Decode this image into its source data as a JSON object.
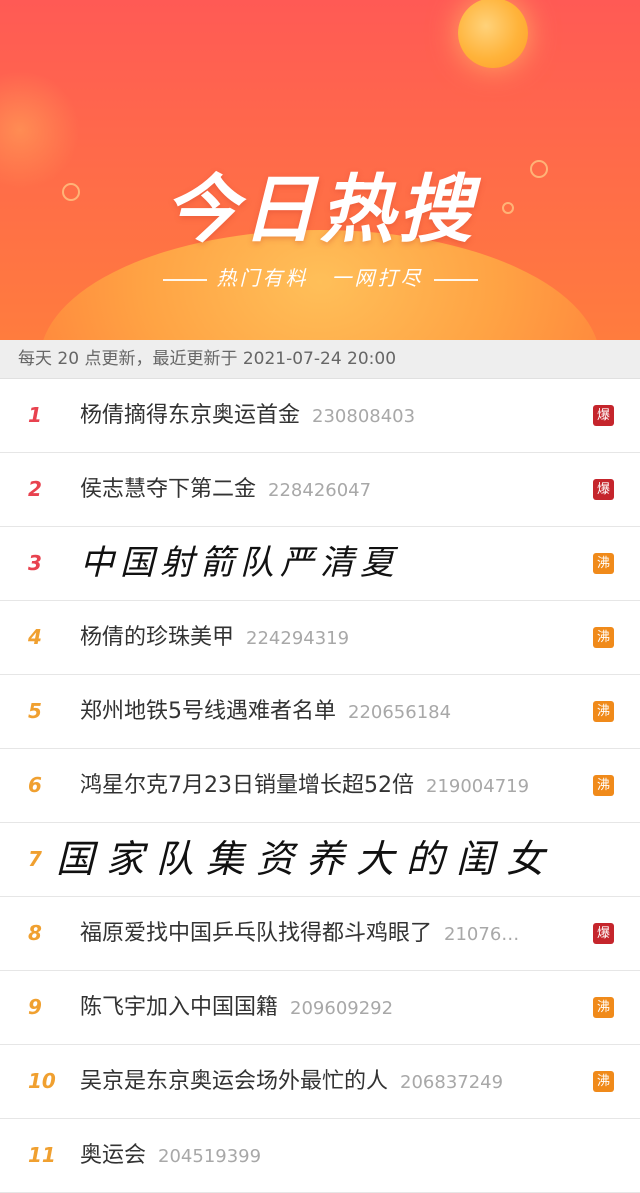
{
  "banner": {
    "title": "今日热搜",
    "subtitle": "热门有料　一网打尽"
  },
  "update_text": "每天 20 点更新，最近更新于 2021-07-24 20:00",
  "badge_colors": {
    "爆": "#c5252c",
    "沸": "#f08a1a"
  },
  "items": [
    {
      "rank": "1",
      "title": "杨倩摘得东京奥运首金",
      "count": "230808403",
      "badge": "爆"
    },
    {
      "rank": "2",
      "title": "侯志慧夺下第二金",
      "count": "228426047",
      "badge": "爆"
    },
    {
      "rank": "3",
      "title": "中国射箭队严清夏",
      "count": "",
      "badge": "沸"
    },
    {
      "rank": "4",
      "title": "杨倩的珍珠美甲",
      "count": "224294319",
      "badge": "沸"
    },
    {
      "rank": "5",
      "title": "郑州地铁5号线遇难者名单",
      "count": "220656184",
      "badge": "沸"
    },
    {
      "rank": "6",
      "title": "鸿星尔克7月23日销量增长超52倍",
      "count": "219004719",
      "badge": "沸"
    },
    {
      "rank": "7",
      "title": "国家队集资养大的闺女",
      "count": "",
      "badge": ""
    },
    {
      "rank": "8",
      "title": "福原爱找中国乒乓队找得都斗鸡眼了",
      "count": "21076…",
      "badge": "爆"
    },
    {
      "rank": "9",
      "title": "陈飞宇加入中国国籍",
      "count": "209609292",
      "badge": "沸"
    },
    {
      "rank": "10",
      "title": "吴京是东京奥运会场外最忙的人",
      "count": "206837249",
      "badge": "沸"
    },
    {
      "rank": "11",
      "title": "奥运会",
      "count": "204519399",
      "badge": ""
    }
  ]
}
